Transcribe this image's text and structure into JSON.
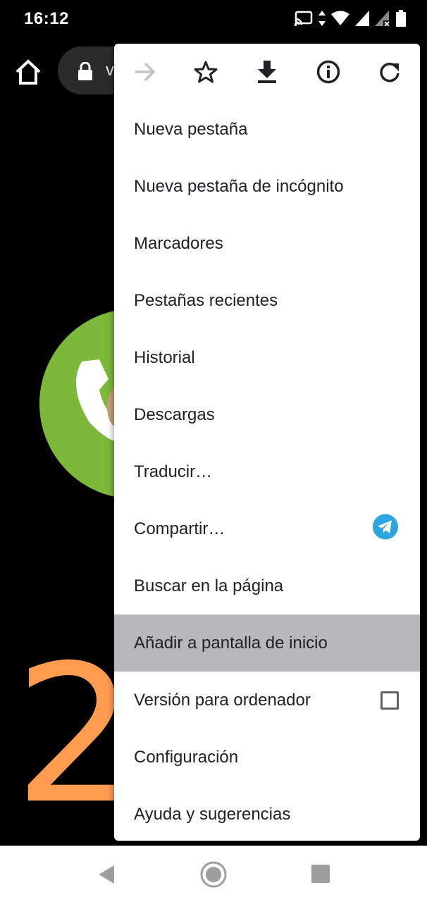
{
  "status_bar": {
    "time": "16:12",
    "icons": [
      "cast-icon",
      "data-arrows-icon",
      "wifi-icon",
      "signal-icon",
      "signal-noservice-icon",
      "battery-icon"
    ]
  },
  "toolbar": {
    "url_text": "v",
    "icons": [
      "home-icon",
      "lock-icon"
    ]
  },
  "menu": {
    "top_icons": [
      "forward-icon",
      "bookmark-star-icon",
      "download-icon",
      "info-icon",
      "reload-icon"
    ],
    "items": [
      {
        "label": "Nueva pestaña"
      },
      {
        "label": "Nueva pestaña de incógnito"
      },
      {
        "label": "Marcadores"
      },
      {
        "label": "Pestañas recientes"
      },
      {
        "label": "Historial"
      },
      {
        "label": "Descargas"
      },
      {
        "label": "Traducir…"
      },
      {
        "label": "Compartir…",
        "trailing_icon": "telegram-icon"
      },
      {
        "label": "Buscar en la página"
      },
      {
        "label": "Añadir a pantalla de inicio",
        "highlighted": true
      },
      {
        "label": "Versión para ordenador",
        "checkbox": false
      },
      {
        "label": "Configuración"
      },
      {
        "label": "Ayuda y sugerencias"
      }
    ]
  },
  "page": {
    "big_number": "2",
    "colors": {
      "logo_green": "#7cb93a",
      "number_orange": "#ff9c50",
      "highlight": "#b7b8ba",
      "telegram": "#2ca5e0"
    }
  },
  "nav_bar": {
    "icons": [
      "back-icon",
      "home-circle-icon",
      "recents-icon"
    ]
  }
}
